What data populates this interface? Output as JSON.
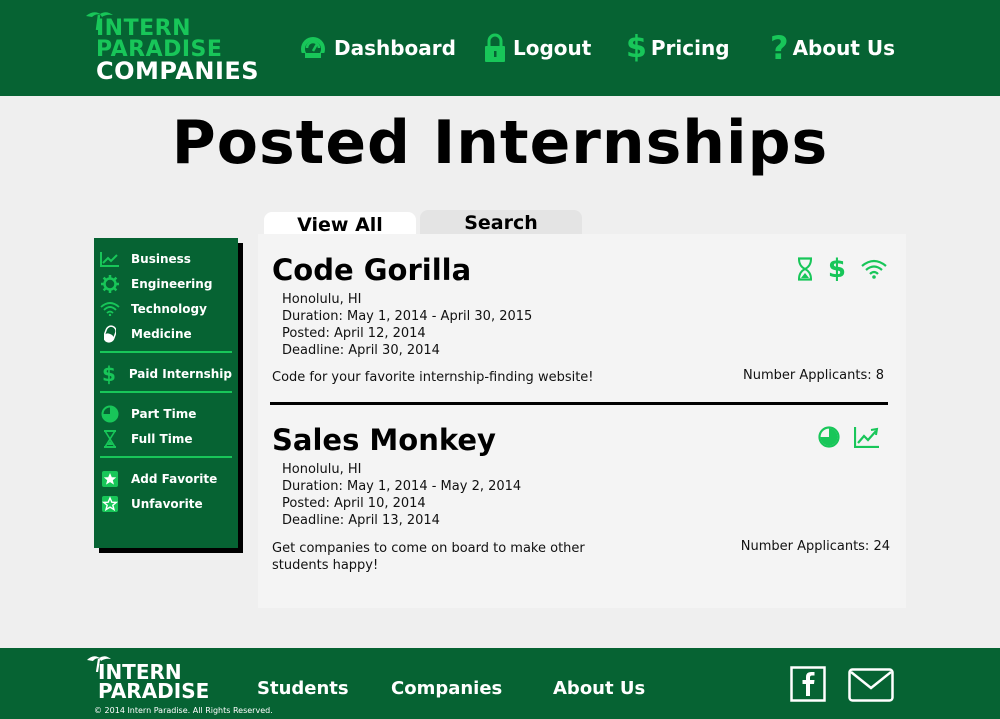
{
  "header": {
    "logo": {
      "line1": "INTERN",
      "line2": "PARADISE",
      "line3": "COMPANIES"
    },
    "nav": [
      {
        "label": "Dashboard",
        "icon": "dashboard-icon"
      },
      {
        "label": "Logout",
        "icon": "lock-icon"
      },
      {
        "label": "Pricing",
        "icon": "dollar-icon"
      },
      {
        "label": "About Us",
        "icon": "question-icon"
      }
    ]
  },
  "page_title": "Posted Internships",
  "sidebar": {
    "groups": [
      [
        {
          "label": "Business",
          "icon": "chart-icon"
        },
        {
          "label": "Engineering",
          "icon": "gear-icon"
        },
        {
          "label": "Technology",
          "icon": "wifi-icon"
        },
        {
          "label": "Medicine",
          "icon": "pill-icon"
        }
      ],
      [
        {
          "label": "Paid Internship",
          "icon": "dollar-icon"
        }
      ],
      [
        {
          "label": "Part Time",
          "icon": "pie-icon"
        },
        {
          "label": "Full Time",
          "icon": "hourglass-icon"
        }
      ],
      [
        {
          "label": "Add Favorite",
          "icon": "star-add-icon"
        },
        {
          "label": "Unfavorite",
          "icon": "star-remove-icon"
        }
      ]
    ]
  },
  "tabs": [
    {
      "label": "View All",
      "active": true
    },
    {
      "label": "Search",
      "active": false
    }
  ],
  "jobs": [
    {
      "title": "Code Gorilla",
      "location": "Honolulu, HI",
      "duration": "Duration: May 1, 2014 - April 30, 2015",
      "posted": "Posted: April 12, 2014",
      "deadline": "Deadline: April 30, 2014",
      "description": "Code for your favorite internship-finding website!",
      "applicants": "Number Applicants: 8",
      "icons": [
        "hourglass-icon",
        "dollar-icon",
        "wifi-icon"
      ]
    },
    {
      "title": "Sales Monkey",
      "location": "Honolulu, HI",
      "duration": "Duration: May 1, 2014 - May 2, 2014",
      "posted": "Posted: April 10, 2014",
      "deadline": "Deadline: April 13, 2014",
      "description": "Get companies to come on board to make other students happy!",
      "applicants": "Number Applicants: 24",
      "icons": [
        "pie-icon",
        "chart-icon"
      ]
    }
  ],
  "footer": {
    "logo": {
      "line1": "INTERN",
      "line2": "PARADISE"
    },
    "copyright": "© 2014 Intern Paradise. All Rights Reserved.",
    "nav": [
      "Students",
      "Companies",
      "About Us"
    ]
  },
  "colors": {
    "brand_dark": "#066333",
    "accent": "#18c659"
  }
}
